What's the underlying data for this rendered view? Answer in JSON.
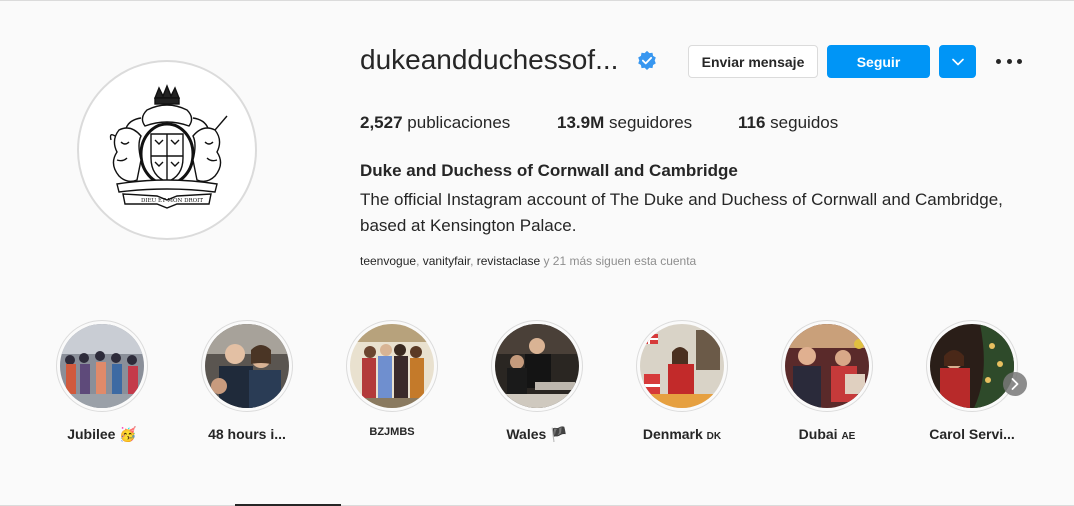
{
  "profile": {
    "username": "dukeandduchessof...",
    "full_name": "Duke and Duchess of Cornwall and Cambridge",
    "bio": "The official Instagram account of The Duke and Duchess of Cornwall and Cambridge, based at Kensington Palace.",
    "verified_icon": "verified-badge-icon",
    "avatar_icon": "royal-coat-of-arms",
    "avatar_motto": "DIEU ET MON DROIT"
  },
  "actions": {
    "message_label": "Enviar mensaje",
    "follow_label": "Seguir",
    "dropdown_icon": "chevron-down-icon",
    "more_icon": "more-options-icon"
  },
  "stats": {
    "posts_count": "2,527",
    "posts_label": "publicaciones",
    "followers_count": "13.9M",
    "followers_label": "seguidores",
    "following_count": "116",
    "following_label": "seguidos"
  },
  "followed_by": {
    "accounts": [
      "teenvogue",
      "vanityfair",
      "revistaclase"
    ],
    "separator": ", ",
    "suffix": " y 21 más siguen esta cuenta"
  },
  "highlights": [
    {
      "title": "Jubilee",
      "emoji": "🥳",
      "suffix": ""
    },
    {
      "title": "48 hours i...",
      "emoji": "",
      "suffix": ""
    },
    {
      "title": "BZJMBS",
      "emoji": "",
      "suffix": ""
    },
    {
      "title": "Wales",
      "emoji": "🏴",
      "suffix": ""
    },
    {
      "title": "Denmark",
      "emoji": "",
      "suffix": "DK"
    },
    {
      "title": "Dubai",
      "emoji": "",
      "suffix": "AE"
    },
    {
      "title": "Carol Servi...",
      "emoji": "",
      "suffix": ""
    }
  ],
  "colors": {
    "accent": "#0095f6",
    "background": "#fafafa",
    "text": "#262626",
    "muted": "#8e8e8e",
    "border": "#dbdbdb"
  }
}
